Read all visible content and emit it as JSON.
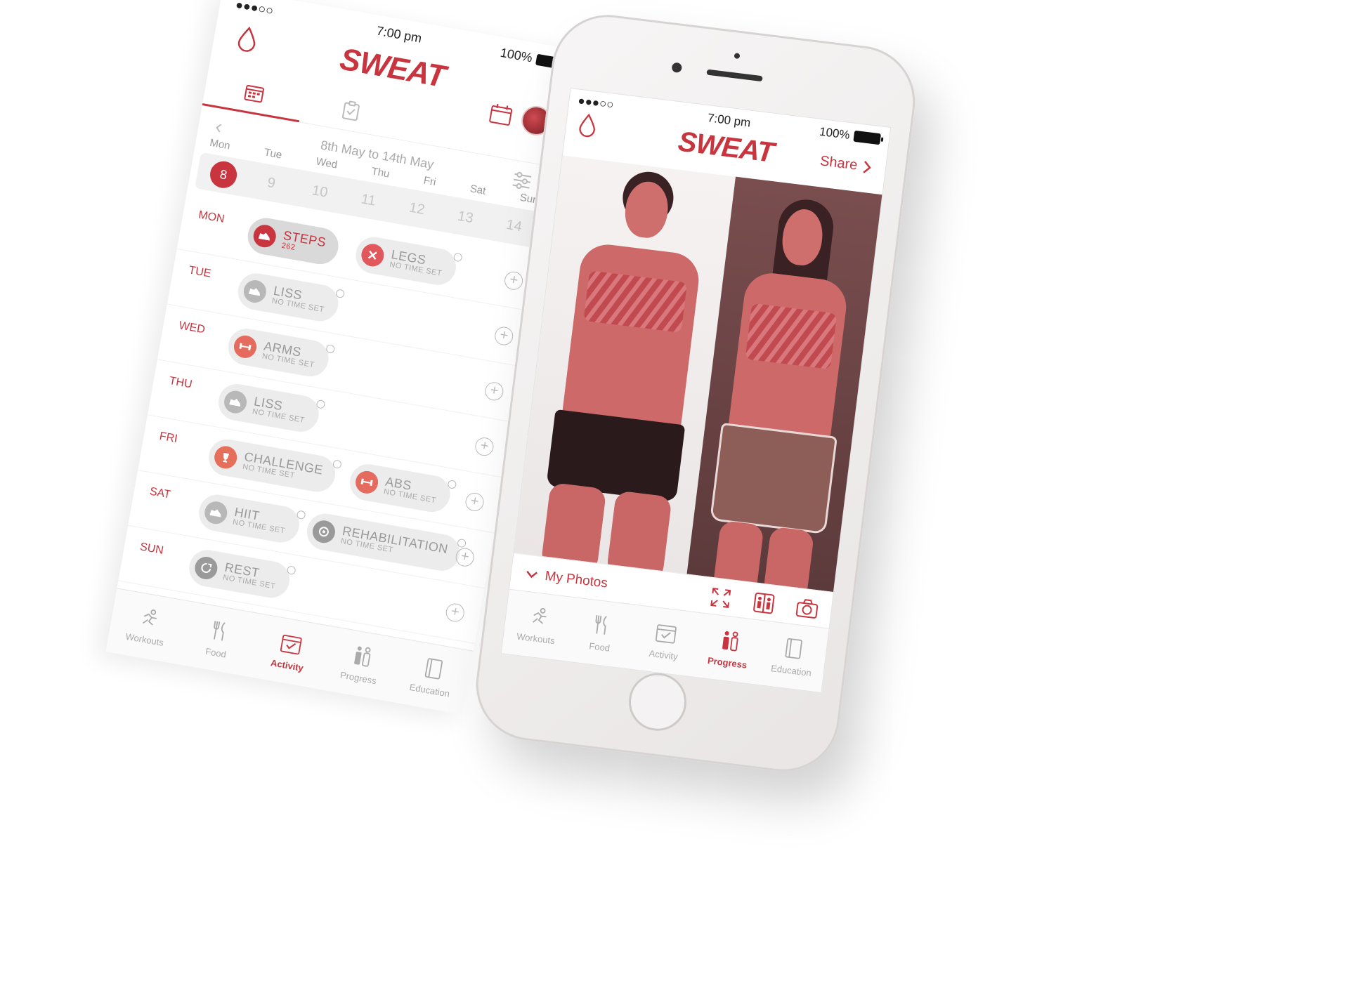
{
  "brand": {
    "name": "SWEAT",
    "accent": "#c8353f"
  },
  "left_screen": {
    "status": {
      "signal": "●●●○○",
      "time": "7:00 pm",
      "battery": "100%"
    },
    "date_range": "8th May to 14th May",
    "week_head": [
      "Mon",
      "Tue",
      "Wed",
      "Thu",
      "Fri",
      "Sat",
      "Sun"
    ],
    "week_days": [
      "8",
      "9",
      "10",
      "11",
      "12",
      "13",
      "14"
    ],
    "selected_day": "8",
    "days": [
      {
        "label": "MON",
        "items": [
          {
            "name": "STEPS",
            "sub": "262",
            "icon": "shoe-icon",
            "selected": true
          },
          {
            "name": "LEGS",
            "sub": "NO TIME SET",
            "icon": "crossed-icon",
            "selected": false
          }
        ]
      },
      {
        "label": "TUE",
        "items": [
          {
            "name": "LISS",
            "sub": "NO TIME SET",
            "icon": "shoe-icon",
            "selected": false
          }
        ]
      },
      {
        "label": "WED",
        "items": [
          {
            "name": "ARMS",
            "sub": "NO TIME SET",
            "icon": "dumbbell-icon",
            "selected": false
          }
        ]
      },
      {
        "label": "THU",
        "items": [
          {
            "name": "LISS",
            "sub": "NO TIME SET",
            "icon": "shoe-icon",
            "selected": false
          }
        ]
      },
      {
        "label": "FRI",
        "items": [
          {
            "name": "CHALLENGE",
            "sub": "NO TIME SET",
            "icon": "trophy-icon",
            "selected": false
          },
          {
            "name": "ABS",
            "sub": "NO TIME SET",
            "icon": "dumbbell-icon",
            "selected": false
          }
        ]
      },
      {
        "label": "SAT",
        "items": [
          {
            "name": "HIIT",
            "sub": "NO TIME SET",
            "icon": "shoe-icon",
            "selected": false
          },
          {
            "name": "REHABILITATION",
            "sub": "NO TIME SET",
            "icon": "rehab-icon",
            "selected": false
          }
        ]
      },
      {
        "label": "SUN",
        "items": [
          {
            "name": "REST",
            "sub": "NO TIME SET",
            "icon": "rest-icon",
            "selected": false
          }
        ]
      }
    ],
    "tabbar": [
      {
        "label": "Workouts",
        "icon": "runner-icon",
        "active": false
      },
      {
        "label": "Food",
        "icon": "cutlery-icon",
        "active": false
      },
      {
        "label": "Activity",
        "icon": "calendar-check-icon",
        "active": true
      },
      {
        "label": "Progress",
        "icon": "progress-icon",
        "active": false
      },
      {
        "label": "Education",
        "icon": "book-icon",
        "active": false
      }
    ]
  },
  "right_phone": {
    "status": {
      "signal": "●●●○○",
      "time": "7:00 pm",
      "battery": "100%"
    },
    "share_label": "Share",
    "my_photos_label": "My Photos",
    "tabbar": [
      {
        "label": "Workouts",
        "icon": "runner-icon",
        "active": false
      },
      {
        "label": "Food",
        "icon": "cutlery-icon",
        "active": false
      },
      {
        "label": "Activity",
        "icon": "calendar-check-icon",
        "active": false
      },
      {
        "label": "Progress",
        "icon": "progress-icon",
        "active": true
      },
      {
        "label": "Education",
        "icon": "book-icon",
        "active": false
      }
    ]
  }
}
